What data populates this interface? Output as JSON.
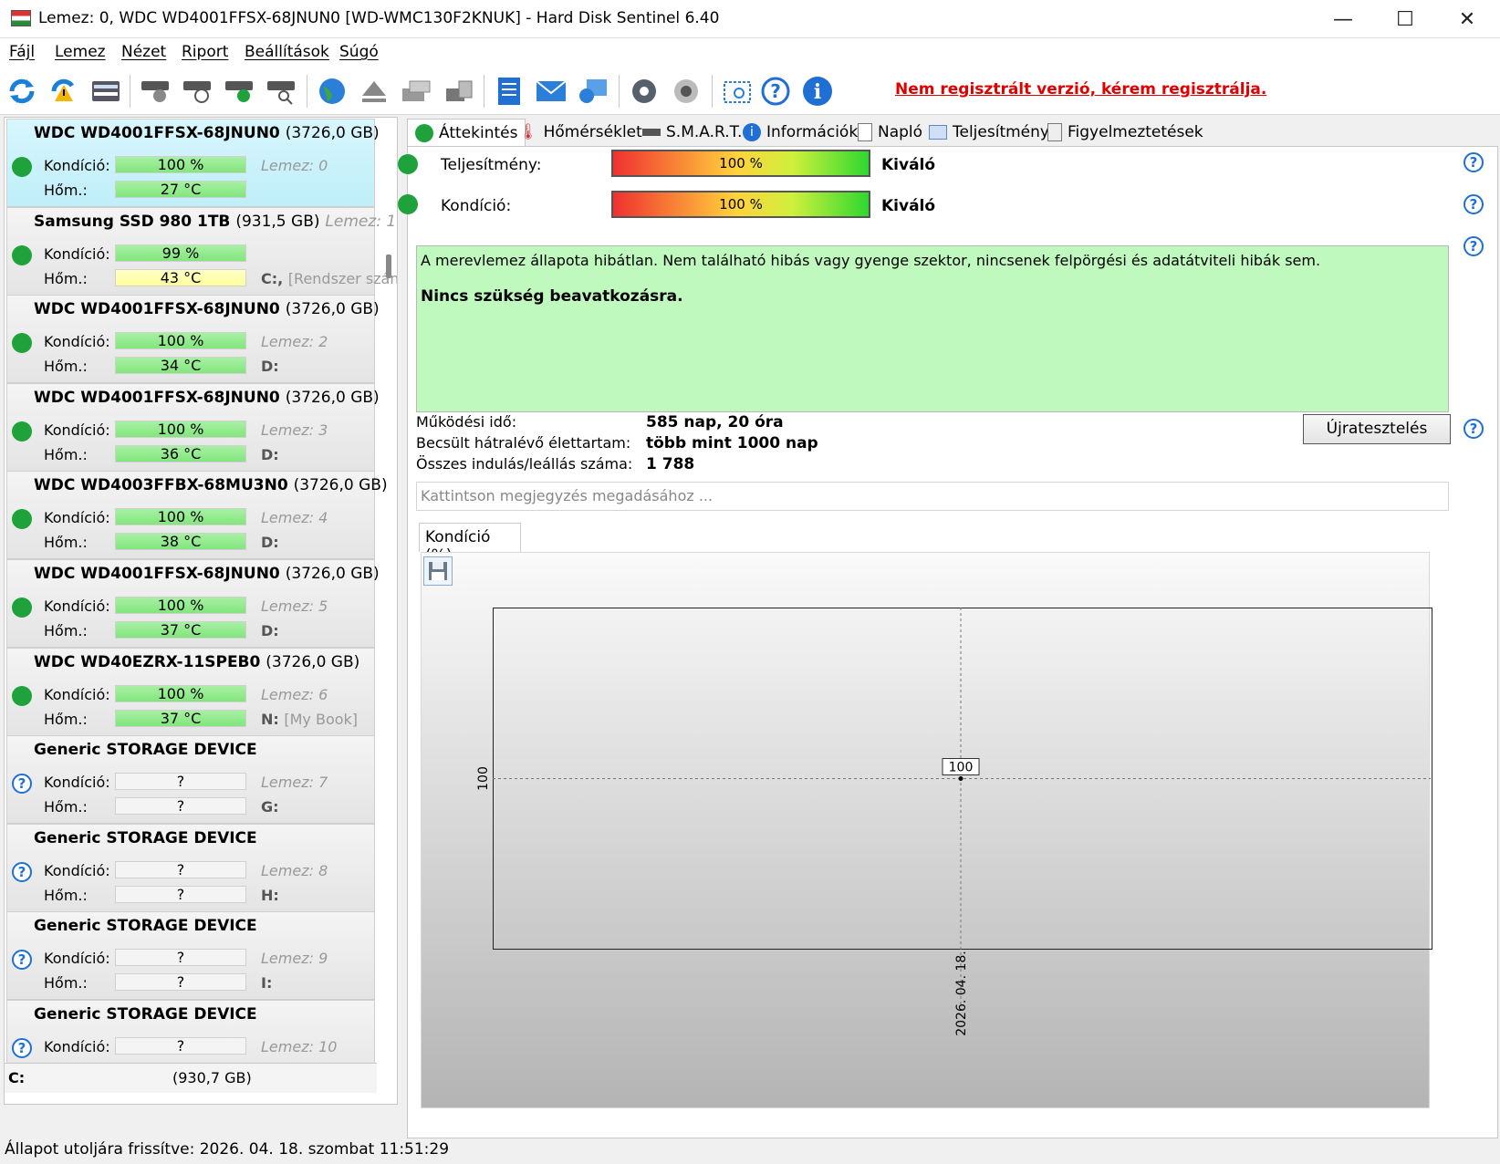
{
  "window": {
    "title": "Lemez: 0, WDC WD4001FFSX-68JNUN0 [WD-WMC130F2KNUK]  -  Hard Disk Sentinel 6.40",
    "minimize": "—",
    "maximize": "☐",
    "close": "✕"
  },
  "menu": [
    "Fájl",
    "Lemez",
    "Nézet",
    "Riport",
    "Beállítások",
    "Súgó"
  ],
  "toolbar": {
    "registration_notice": "Nem regisztrált verzió, kérem regisztrálja."
  },
  "disks": [
    {
      "name": "WDC WD4001FFSX-68JNUN0",
      "size": "(3726,0 GB)",
      "condition": "100 %",
      "temp": "27 °C",
      "disk_label": "Lemez: 0",
      "drive": "",
      "status": "ok",
      "temp_color": "green",
      "selected": true
    },
    {
      "name": "Samsung SSD 980 1TB",
      "size": "(931,5 GB)",
      "disk_label": "Lemez: 1",
      "condition": "99 %",
      "temp": "43 °C",
      "drive": "C:,",
      "drive2": "[Rendszer számá",
      "status": "ok",
      "temp_color": "yellow"
    },
    {
      "name": "WDC WD4001FFSX-68JNUN0",
      "size": "(3726,0 GB)",
      "condition": "100 %",
      "temp": "34 °C",
      "disk_label": "Lemez: 2",
      "drive": "D:",
      "status": "ok",
      "temp_color": "green"
    },
    {
      "name": "WDC WD4001FFSX-68JNUN0",
      "size": "(3726,0 GB)",
      "condition": "100 %",
      "temp": "36 °C",
      "disk_label": "Lemez: 3",
      "drive": "D:",
      "status": "ok",
      "temp_color": "green"
    },
    {
      "name": "WDC WD4003FFBX-68MU3N0",
      "size": "(3726,0 GB)",
      "condition": "100 %",
      "temp": "38 °C",
      "disk_label": "Lemez: 4",
      "drive": "D:",
      "status": "ok",
      "temp_color": "green"
    },
    {
      "name": "WDC WD4001FFSX-68JNUN0",
      "size": "(3726,0 GB)",
      "condition": "100 %",
      "temp": "37 °C",
      "disk_label": "Lemez: 5",
      "drive": "D:",
      "status": "ok",
      "temp_color": "green"
    },
    {
      "name": "WDC WD40EZRX-11SPEB0",
      "size": "(3726,0 GB)",
      "condition": "100 %",
      "temp": "37 °C",
      "disk_label": "Lemez: 6",
      "drive": "N:",
      "drive2": "[My Book]",
      "status": "ok",
      "temp_color": "green"
    },
    {
      "name": "Generic STORAGE DEVICE",
      "size": "",
      "condition": "?",
      "temp": "?",
      "disk_label": "Lemez: 7",
      "drive": "G:",
      "status": "unknown",
      "temp_color": "empty"
    },
    {
      "name": "Generic STORAGE DEVICE",
      "size": "",
      "condition": "?",
      "temp": "?",
      "disk_label": "Lemez: 8",
      "drive": "H:",
      "status": "unknown",
      "temp_color": "empty"
    },
    {
      "name": "Generic STORAGE DEVICE",
      "size": "",
      "condition": "?",
      "temp": "?",
      "disk_label": "Lemez: 9",
      "drive": "I:",
      "status": "unknown",
      "temp_color": "empty"
    },
    {
      "name": "Generic STORAGE DEVICE",
      "size": "",
      "condition": "?",
      "temp": "",
      "disk_label": "Lemez: 10",
      "drive": "",
      "status": "unknown",
      "temp_color": "empty"
    }
  ],
  "labels": {
    "condition": "Kondíció:",
    "temp": "Hőm.:"
  },
  "partition": {
    "drive": "C:",
    "size": "(930,7 GB)"
  },
  "tabs": [
    "Áttekintés",
    "Hőmérséklet",
    "S.M.A.R.T.",
    "Információk",
    "Napló",
    "Teljesítmény",
    "Figyelmeztetések"
  ],
  "overview": {
    "performance_label": "Teljesítmény:",
    "performance_value": "100 %",
    "performance_level": 100,
    "performance_rating": "Kiváló",
    "condition_label": "Kondíció:",
    "condition_value": "100 %",
    "condition_level": 100,
    "condition_rating": "Kiváló",
    "message": "A merevlemez állapota hibátlan. Nem található hibás vagy gyenge szektor, nincsenek felpörgési és adatátviteli hibák sem.",
    "message_action": "Nincs szükség beavatkozásra.",
    "stats": [
      {
        "label": "Működési idő:",
        "value": "585 nap, 20 óra"
      },
      {
        "label": "Becsült hátralévő élettartam:",
        "value": "több mint 1000 nap"
      },
      {
        "label": "Összes indulás/leállás száma:",
        "value": "1 788"
      }
    ],
    "retest_button": "Újratesztelés",
    "note_placeholder": "Kattintson megjegyzés megadásához ..."
  },
  "chart_tab": "Kondíció  (%)",
  "chart_data": {
    "type": "line",
    "title": "",
    "x": [
      "2026. 04. 18."
    ],
    "series": [
      {
        "values": [
          100
        ]
      }
    ],
    "y_tick": "100",
    "point_label": "100",
    "grid": true
  },
  "statusbar": "Állapot utoljára frissítve: 2026. 04. 18. szombat 11:51:29"
}
